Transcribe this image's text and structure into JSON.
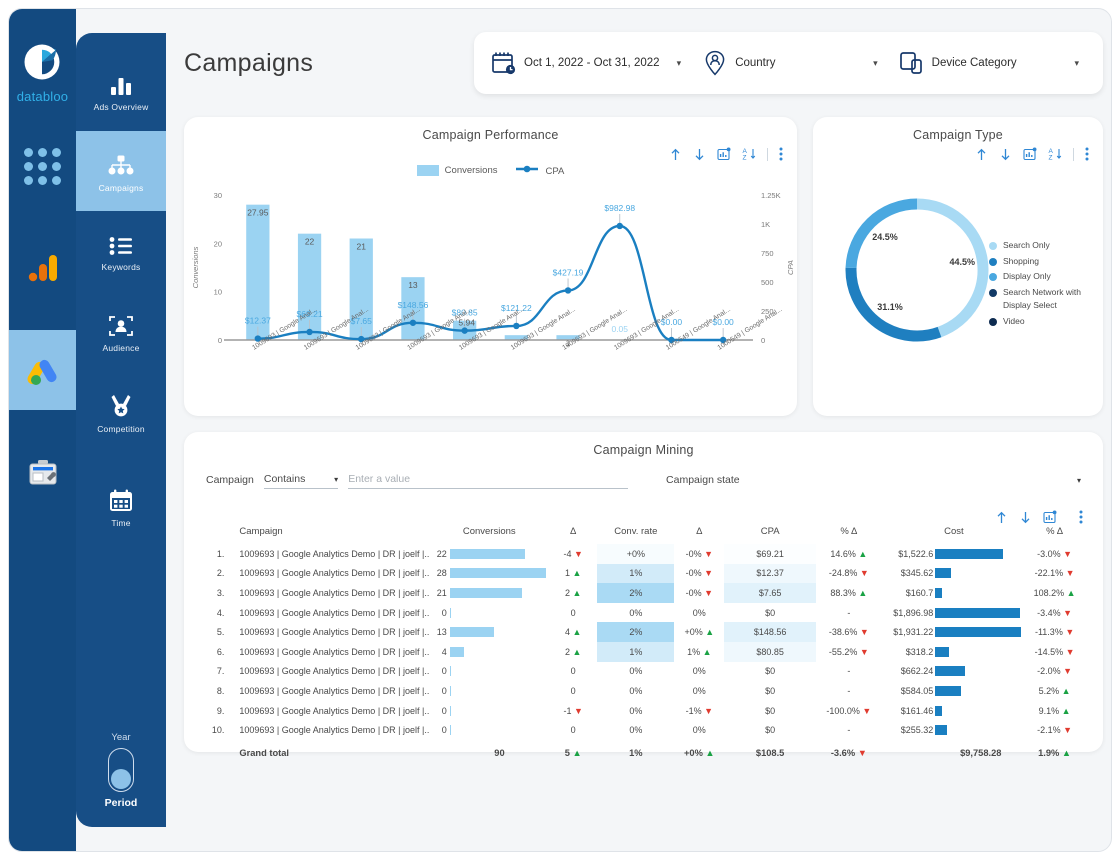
{
  "brand": {
    "name": "databloo"
  },
  "rail": {
    "items": [
      {
        "name": "apps-grid-icon",
        "label": ""
      },
      {
        "name": "google-analytics-icon",
        "label": ""
      },
      {
        "name": "google-ads-icon",
        "label": "",
        "active": true
      },
      {
        "name": "google-tag-manager-icon",
        "label": ""
      }
    ]
  },
  "sidebar": {
    "items": [
      {
        "label": "Ads Overview",
        "icon": "bar-chart-icon",
        "active": false
      },
      {
        "label": "Campaigns",
        "icon": "hierarchy-icon",
        "active": true
      },
      {
        "label": "Keywords",
        "icon": "list-icon",
        "active": false
      },
      {
        "label": "Audience",
        "icon": "person-frame-icon",
        "active": false
      },
      {
        "label": "Competition",
        "icon": "medal-icon",
        "active": false
      },
      {
        "label": "Time",
        "icon": "calendar-icon",
        "active": false
      }
    ],
    "period_toggle": {
      "top_label": "Year",
      "bottom_label": "Period"
    }
  },
  "header": {
    "title": "Campaigns",
    "filters": [
      {
        "label": "Oct 1, 2022 - Oct 31, 2022",
        "icon": "calendar-clock-icon"
      },
      {
        "label": "Country",
        "icon": "location-person-icon"
      },
      {
        "label": "Device Category",
        "icon": "devices-icon"
      }
    ]
  },
  "toolbar_icons": [
    "sort-asc-icon",
    "sort-desc-icon",
    "drill-chart-icon",
    "sort-alpha-icon",
    "more-vertical-icon"
  ],
  "performance_card": {
    "title": "Campaign Performance",
    "legend": [
      "Conversions",
      "CPA"
    ]
  },
  "type_card": {
    "title": "Campaign Type"
  },
  "mining_card": {
    "title": "Campaign Mining",
    "filter": {
      "field_label": "Campaign",
      "operator": "Contains",
      "value_placeholder": "Enter a value",
      "state_label": "Campaign state"
    },
    "columns": [
      "Campaign",
      "Conversions",
      "Δ",
      "Conv. rate",
      "Δ",
      "CPA",
      "% Δ",
      "Cost",
      "% Δ"
    ],
    "rows": [
      {
        "idx": "1.",
        "campaign": "1009693 | Google Analytics Demo | DR | joelf |..",
        "conversions": 22,
        "conv_delta": "-4",
        "conv_dir": "down",
        "rate": "+0%",
        "rate_delta": "-0%",
        "rate_dir": "down",
        "cpa": "$69.21",
        "cpa_pct": "14.6%",
        "cpa_dir": "up",
        "cost": "$1,522.6",
        "cost_val": 1522.6,
        "cost_pct": "-3.0%",
        "cost_dir": "down",
        "rate_shade": 0.08
      },
      {
        "idx": "2.",
        "campaign": "1009693 | Google Analytics Demo | DR | joelf |..",
        "conversions": 28,
        "conv_delta": "1",
        "conv_dir": "up",
        "rate": "1%",
        "rate_delta": "-0%",
        "rate_dir": "down",
        "cpa": "$12.37",
        "cpa_pct": "-24.8%",
        "cpa_dir": "down",
        "cost": "$345.62",
        "cost_val": 345.62,
        "cost_pct": "-22.1%",
        "cost_dir": "down",
        "rate_shade": 0.45
      },
      {
        "idx": "3.",
        "campaign": "1009693 | Google Analytics Demo | DR | joelf |..",
        "conversions": 21,
        "conv_delta": "2",
        "conv_dir": "up",
        "rate": "2%",
        "rate_delta": "-0%",
        "rate_dir": "down",
        "cpa": "$7.65",
        "cpa_pct": "88.3%",
        "cpa_dir": "up",
        "cost": "$160.7",
        "cost_val": 160.7,
        "cost_pct": "108.2%",
        "cost_dir": "up",
        "rate_shade": 0.85
      },
      {
        "idx": "4.",
        "campaign": "1009693 | Google Analytics Demo | DR | joelf |..",
        "conversions": 0,
        "conv_delta": "0",
        "conv_dir": "none",
        "rate": "0%",
        "rate_delta": "0%",
        "rate_dir": "none",
        "cpa": "$0",
        "cpa_pct": "-",
        "cpa_dir": "none",
        "cost": "$1,896.98",
        "cost_val": 1896.98,
        "cost_pct": "-3.4%",
        "cost_dir": "down",
        "rate_shade": 0
      },
      {
        "idx": "5.",
        "campaign": "1009693 | Google Analytics Demo | DR | joelf |..",
        "conversions": 13,
        "conv_delta": "4",
        "conv_dir": "up",
        "rate": "2%",
        "rate_delta": "+0%",
        "rate_dir": "up",
        "cpa": "$148.56",
        "cpa_pct": "-38.6%",
        "cpa_dir": "down",
        "cost": "$1,931.22",
        "cost_val": 1931.22,
        "cost_pct": "-11.3%",
        "cost_dir": "down",
        "rate_shade": 0.85
      },
      {
        "idx": "6.",
        "campaign": "1009693 | Google Analytics Demo | DR | joelf |..",
        "conversions": 4,
        "conv_delta": "2",
        "conv_dir": "up",
        "rate": "1%",
        "rate_delta": "1%",
        "rate_dir": "up",
        "cpa": "$80.85",
        "cpa_pct": "-55.2%",
        "cpa_dir": "down",
        "cost": "$318.2",
        "cost_val": 318.2,
        "cost_pct": "-14.5%",
        "cost_dir": "down",
        "rate_shade": 0.45
      },
      {
        "idx": "7.",
        "campaign": "1009693 | Google Analytics Demo | DR | joelf |..",
        "conversions": 0,
        "conv_delta": "0",
        "conv_dir": "none",
        "rate": "0%",
        "rate_delta": "0%",
        "rate_dir": "none",
        "cpa": "$0",
        "cpa_pct": "-",
        "cpa_dir": "none",
        "cost": "$662.24",
        "cost_val": 662.24,
        "cost_pct": "-2.0%",
        "cost_dir": "down",
        "rate_shade": 0
      },
      {
        "idx": "8.",
        "campaign": "1009693 | Google Analytics Demo | DR | joelf |..",
        "conversions": 0,
        "conv_delta": "0",
        "conv_dir": "none",
        "rate": "0%",
        "rate_delta": "0%",
        "rate_dir": "none",
        "cpa": "$0",
        "cpa_pct": "-",
        "cpa_dir": "none",
        "cost": "$584.05",
        "cost_val": 584.05,
        "cost_pct": "5.2%",
        "cost_dir": "up",
        "rate_shade": 0
      },
      {
        "idx": "9.",
        "campaign": "1009693 | Google Analytics Demo | DR | joelf |..",
        "conversions": 0,
        "conv_delta": "-1",
        "conv_dir": "down",
        "rate": "0%",
        "rate_delta": "-1%",
        "rate_dir": "down",
        "cpa": "$0",
        "cpa_pct": "-100.0%",
        "cpa_dir": "down",
        "cost": "$161.46",
        "cost_val": 161.46,
        "cost_pct": "9.1%",
        "cost_dir": "up",
        "rate_shade": 0
      },
      {
        "idx": "10.",
        "campaign": "1009693 | Google Analytics Demo | DR | joelf |..",
        "conversions": 0,
        "conv_delta": "0",
        "conv_dir": "none",
        "rate": "0%",
        "rate_delta": "0%",
        "rate_dir": "none",
        "cpa": "$0",
        "cpa_pct": "-",
        "cpa_dir": "none",
        "cost": "$255.32",
        "cost_val": 255.32,
        "cost_pct": "-2.1%",
        "cost_dir": "down",
        "rate_shade": 0
      }
    ],
    "total": {
      "label": "Grand total",
      "conversions": "90",
      "conv_delta": "5",
      "conv_dir": "up",
      "rate": "1%",
      "rate_delta": "+0%",
      "rate_dir": "up",
      "cpa": "$108.5",
      "cpa_pct": "-3.6%",
      "cpa_dir": "down",
      "cost": "$9,758.28",
      "cost_pct": "1.9%",
      "cost_dir": "up"
    }
  },
  "colors": {
    "navy": "#134a80",
    "sidenav": "#174e86",
    "active_blue": "#8dc2e8",
    "bar_light": "#9bd3f2",
    "line_blue": "#1a7fc1",
    "cost_bar": "#1a7fc1",
    "donut_light": "#a8daf4",
    "donut_mid": "#4aa8e0",
    "donut_dark": "#1f7fc0",
    "up_green": "#1aa244",
    "down_red": "#e03b2f"
  },
  "chart_data": [
    {
      "type": "bar",
      "title": "Campaign Performance",
      "xlabel": "",
      "ylabel": "Conversions",
      "y2label": "CPA",
      "ylim": [
        0,
        30
      ],
      "yticks": [
        0,
        10,
        20,
        30
      ],
      "y2lim": [
        0,
        1250
      ],
      "y2ticks": [
        "0",
        "250",
        "500",
        "750",
        "1K",
        "1.25K"
      ],
      "categories": [
        "1009693 | Google Anal...",
        "1009693 | Google Anal...",
        "1009693 | Google Anal...",
        "1009693 | Google Anal...",
        "1009693 | Google Anal...",
        "1009693 | Google Anal...",
        "1009693 | Google Anal...",
        "1009693 | Google Anal...",
        "1000549 | Google Anal...",
        "1000549 | Google Anal..."
      ],
      "series": [
        {
          "name": "Conversions",
          "type": "bar",
          "values": [
            28,
            22,
            21,
            13,
            4,
            1,
            1,
            0,
            0,
            0
          ],
          "labels": [
            "27.95",
            "22",
            "21",
            "13",
            "",
            "",
            "1",
            "0.05",
            "",
            ""
          ]
        },
        {
          "name": "CPA",
          "type": "line",
          "values": [
            12.37,
            69.21,
            7.65,
            148.56,
            80.85,
            121.22,
            427.19,
            982.98,
            0,
            0
          ],
          "labels": [
            "$12.37",
            "$69.21",
            "$7.65",
            "$148.56",
            "$80.85",
            "$121.22",
            "$427.19",
            "$982.98",
            "$0.00",
            "$0.00"
          ]
        }
      ],
      "extra_labels": [
        "5.94"
      ],
      "legend_position": "top"
    },
    {
      "type": "pie",
      "title": "Campaign Type",
      "labels": [
        "Search Only",
        "Shopping",
        "Display Only",
        "Search Network with Display Select",
        "Video"
      ],
      "values": [
        44.5,
        31.1,
        24.5,
        0,
        0
      ],
      "value_labels": [
        "44.5%",
        "31.1%",
        "24.5%",
        "",
        ""
      ],
      "colors": [
        "#a8daf4",
        "#1f7fc0",
        "#4aa8e0",
        "#123a66",
        "#0d2b50"
      ],
      "legend_position": "right",
      "donut": true
    }
  ]
}
